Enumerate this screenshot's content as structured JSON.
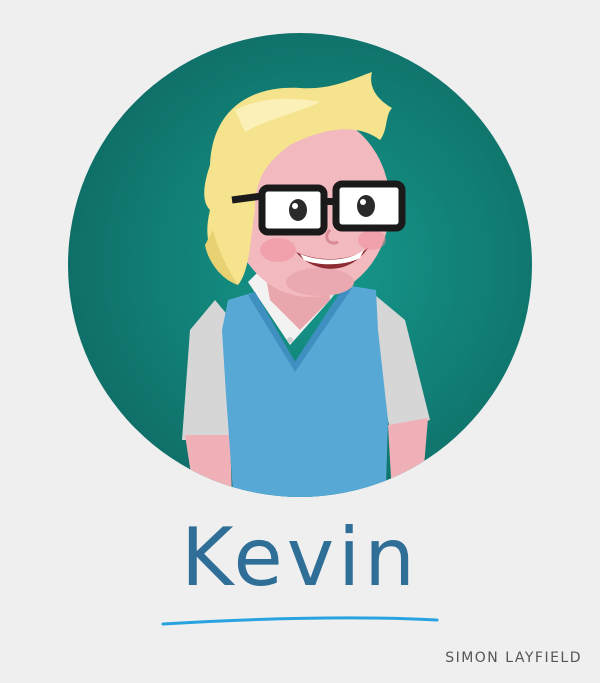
{
  "character": {
    "name": "Kevin"
  },
  "signature": "SIMON LAYFIELD",
  "colors": {
    "background": "#efefef",
    "circle": "#137d74",
    "circle_center": "#14968a",
    "hair": "#f3e48a",
    "skin": "#f2b8bd",
    "vest": "#58a7d4",
    "shirt": "#d8d8d8",
    "glasses": "#1a1a1a",
    "name_text": "#2f6f97",
    "underline": "#29a3e0"
  }
}
